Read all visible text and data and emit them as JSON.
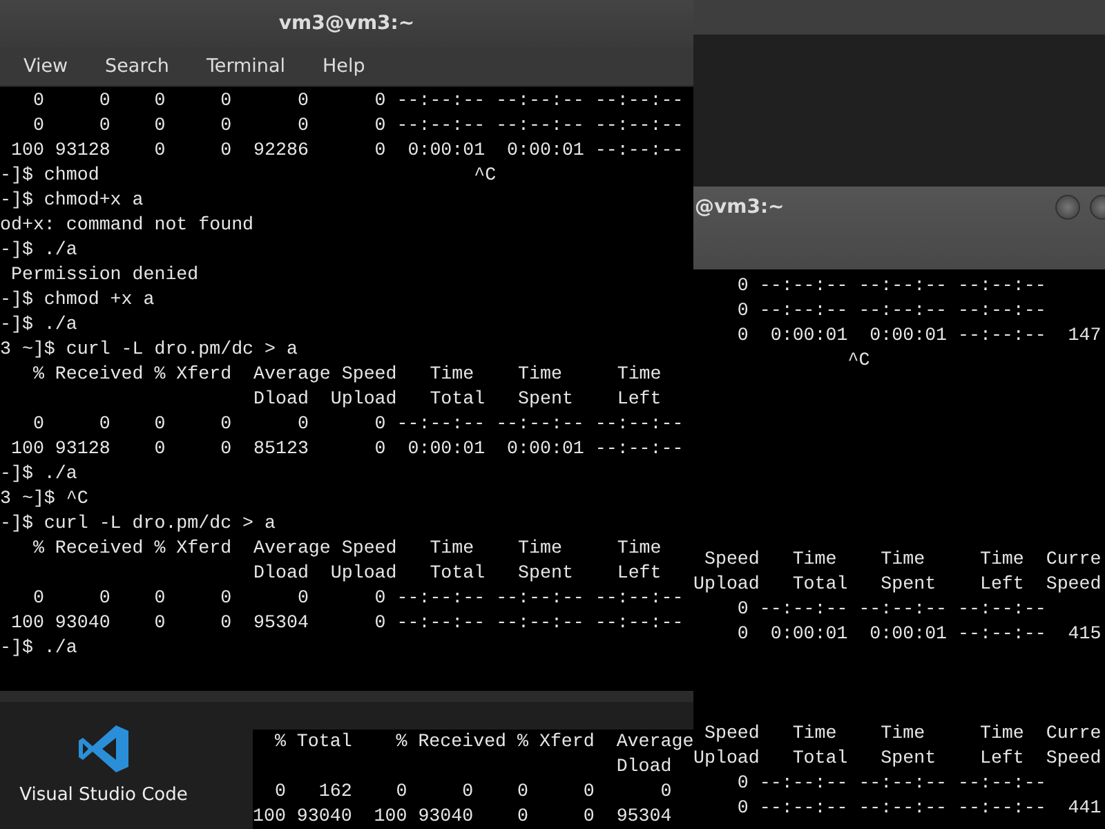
{
  "main_terminal": {
    "title": "vm3@vm3:~",
    "menu": [
      "View",
      "Search",
      "Terminal",
      "Help"
    ],
    "lines": [
      "   0     0    0     0      0      0 --:--:-- --:--:-- --:--:--",
      "   0     0    0     0      0      0 --:--:-- --:--:-- --:--:--",
      " 100 93128    0     0  92286      0  0:00:01  0:00:01 --:--:--",
      "-]$ chmod                                  ^C",
      "-]$ chmod+x a",
      "od+x: command not found",
      "-]$ ./a",
      " Permission denied",
      "-]$ chmod +x a",
      "-]$ ./a",
      "3 ~]$ curl -L dro.pm/dc > a",
      "   % Received % Xferd  Average Speed   Time    Time     Time",
      "                       Dload  Upload   Total   Spent    Left",
      "   0     0    0     0      0      0 --:--:-- --:--:-- --:--:--",
      " 100 93128    0     0  85123      0  0:00:01  0:00:01 --:--:--",
      "-]$ ./a",
      "3 ~]$ ^C",
      "-]$ curl -L dro.pm/dc > a",
      "   % Received % Xferd  Average Speed   Time    Time     Time",
      "                       Dload  Upload   Total   Spent    Left",
      "   0     0    0     0      0      0 --:--:-- --:--:-- --:--:--",
      " 100 93040    0     0  95304      0 --:--:-- --:--:-- --:--:--",
      "-]$ ./a"
    ]
  },
  "right_terminal": {
    "title": "@vm3:~",
    "blocks": [
      {
        "lines": [
          "    0 --:--:-- --:--:-- --:--:--",
          "    0 --:--:-- --:--:-- --:--:--",
          "    0  0:00:01  0:00:01 --:--:--  147",
          "              ^C"
        ]
      },
      {
        "lines": [
          " Speed   Time    Time     Time  Curre",
          "Upload   Total   Spent    Left  Speed",
          "    0 --:--:-- --:--:-- --:--:--",
          "    0  0:00:01  0:00:01 --:--:--  415"
        ]
      },
      {
        "lines": [
          " Speed   Time    Time     Time  Curre",
          "Upload   Total   Spent    Left  Speed",
          "    0 --:--:-- --:--:-- --:--:--",
          "    0 --:--:-- --:--:-- --:--:--  441"
        ]
      }
    ]
  },
  "bottom_terminal": {
    "lines": [
      "  % Total    % Received % Xferd  Average",
      "                                 Dload",
      "  0   162    0     0    0     0      0",
      "100 93040  100 93040    0     0  95304"
    ]
  },
  "desktop_icons": [
    {
      "label": "Visual Studio Code"
    }
  ]
}
